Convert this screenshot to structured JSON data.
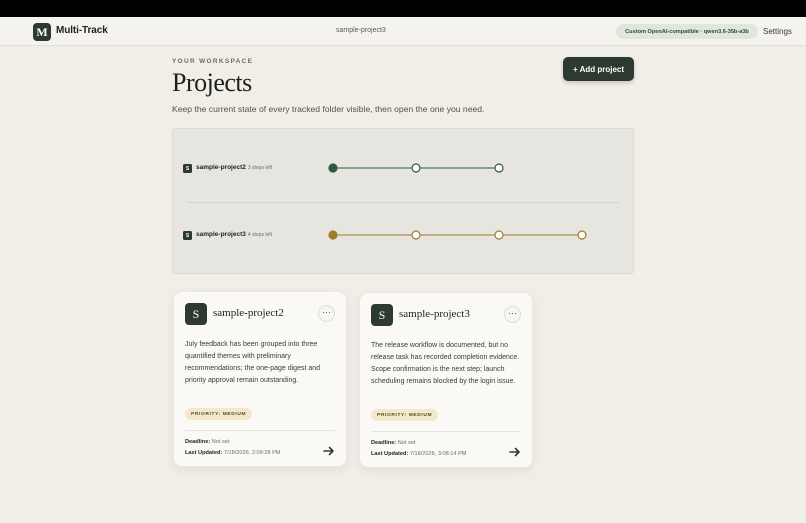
{
  "app": {
    "logo_letter": "M",
    "name": "Multi-Track"
  },
  "nav": {
    "current_project": "sample-project3",
    "model_pill": "Custom OpenAI-compatible · qwen3.6-35b-a3b",
    "settings_label": "Settings"
  },
  "header": {
    "eyebrow": "YOUR WORKSPACE",
    "title": "Projects",
    "subtitle": "Keep the current state of every tracked folder visible, then open the one you need.",
    "add_label": "+ Add project"
  },
  "tracker": {
    "rows": [
      {
        "badge": "S",
        "name": "sample-project2",
        "steps_left": "3 steps left",
        "total_steps": 3,
        "completed_steps": 1,
        "accent": "#2f5a3c"
      },
      {
        "badge": "S",
        "name": "sample-project3",
        "steps_left": "4 steps left",
        "total_steps": 4,
        "completed_steps": 1,
        "accent": "#a07b2a"
      }
    ]
  },
  "cards": [
    {
      "avatar": "S",
      "title": "sample-project2",
      "menu": "···",
      "description": "July feedback has been grouped into three quantified themes with preliminary recommendations; the one-page digest and priority approval remain outstanding.",
      "priority": "PRIORITY: MEDIUM",
      "deadline_label": "Deadline:",
      "deadline_value": "Not set",
      "updated_label": "Last Updated:",
      "updated_value": "7/18/2026, 2:09:28 PM"
    },
    {
      "avatar": "S",
      "title": "sample-project3",
      "menu": "···",
      "description": "The release workflow is documented, but no release task has recorded completion evidence. Scope confirmation is the next step; launch scheduling remains blocked by the login issue.",
      "priority": "PRIORITY: MEDIUM",
      "deadline_label": "Deadline:",
      "deadline_value": "Not set",
      "updated_label": "Last Updated:",
      "updated_value": "7/18/2026, 3:08:14 PM"
    }
  ],
  "colors": {
    "brand_dark": "#2d3a31",
    "background": "#f1eee8",
    "accent_green": "#2f5a3c",
    "accent_gold": "#a07b2a",
    "priority_bg": "#f3e8cb"
  },
  "icons": {
    "arrow": "arrow-right-icon",
    "menu": "more-horizontal-icon"
  }
}
